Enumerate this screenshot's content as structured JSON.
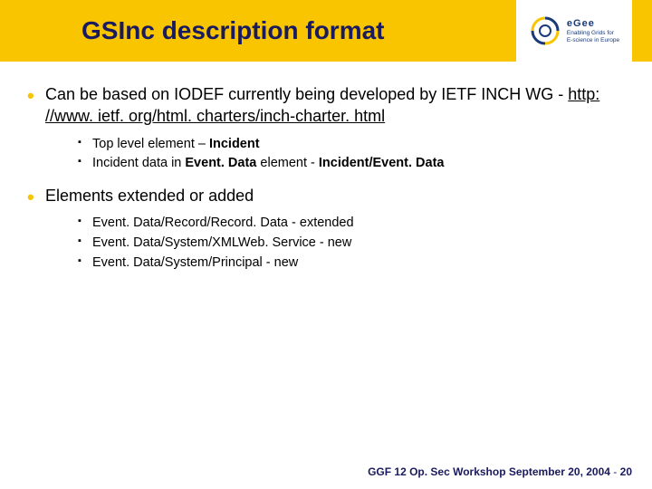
{
  "header": {
    "title": "GSInc description format"
  },
  "logo": {
    "brand": "eGee",
    "line1": "Enabling Grids for",
    "line2": "E-science in Europe"
  },
  "bullets": [
    {
      "text_pre": "Can be based on IODEF currently being developed by IETF INCH WG - ",
      "link": "http: //www. ietf. org/html. charters/inch-charter. html",
      "subs": [
        {
          "pre": "Top level element – ",
          "bold": "Incident",
          "post": ""
        },
        {
          "pre": "Incident data in ",
          "bold": "Event. Data",
          "post": " element - ",
          "bold2": "Incident/Event. Data"
        }
      ]
    },
    {
      "text_pre": "Elements extended or added",
      "link": "",
      "subs": [
        {
          "pre": "Event. Data/Record/Record. Data - extended",
          "bold": "",
          "post": ""
        },
        {
          "pre": "Event. Data/System/XMLWeb. Service - new",
          "bold": "",
          "post": ""
        },
        {
          "pre": "Event. Data/System/Principal - new",
          "bold": "",
          "post": ""
        }
      ]
    }
  ],
  "footer": {
    "text": "GGF 12 Op. Sec Workshop September 20, 2004",
    "page": "20"
  }
}
